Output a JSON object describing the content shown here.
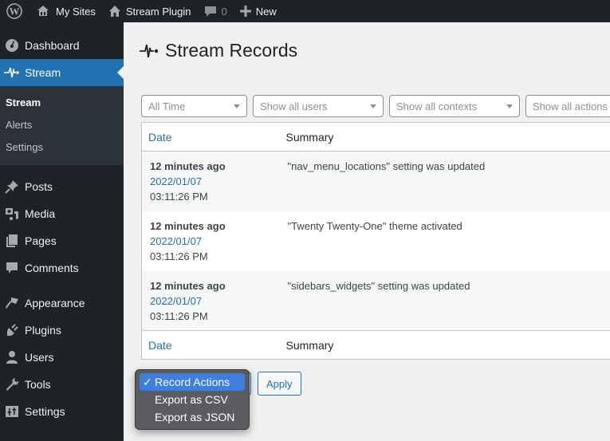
{
  "adminbar": {
    "wp_logo_icon": "wordpress-logo-icon",
    "my_sites": "My Sites",
    "site_name": "Stream Plugin",
    "comments_count": "0",
    "new_label": "New"
  },
  "sidebar": {
    "items": [
      {
        "label": "Dashboard",
        "icon": "dashboard-icon"
      },
      {
        "label": "Stream",
        "icon": "stream-icon",
        "current": true
      },
      {
        "label": "Posts",
        "icon": "pin-icon"
      },
      {
        "label": "Media",
        "icon": "media-icon"
      },
      {
        "label": "Pages",
        "icon": "pages-icon"
      },
      {
        "label": "Comments",
        "icon": "comments-icon"
      },
      {
        "label": "Appearance",
        "icon": "brush-icon"
      },
      {
        "label": "Plugins",
        "icon": "plugin-icon"
      },
      {
        "label": "Users",
        "icon": "user-icon"
      },
      {
        "label": "Tools",
        "icon": "wrench-icon"
      },
      {
        "label": "Settings",
        "icon": "settings-icon"
      }
    ],
    "submenu": [
      {
        "label": "Stream",
        "active": true
      },
      {
        "label": "Alerts"
      },
      {
        "label": "Settings"
      }
    ]
  },
  "page": {
    "title": "Stream Records"
  },
  "filters": [
    {
      "value": "All Time"
    },
    {
      "value": "Show all users"
    },
    {
      "value": "Show all contexts"
    },
    {
      "value": "Show all actions"
    }
  ],
  "table": {
    "columns": [
      "Date",
      "Summary"
    ],
    "rows": [
      {
        "ago": "12 minutes ago",
        "date": "2022/01/07",
        "time": "03:11:26 PM",
        "summary": "\"nav_menu_locations\" setting was updated"
      },
      {
        "ago": "12 minutes ago",
        "date": "2022/01/07",
        "time": "03:11:26 PM",
        "summary": "\"Twenty Twenty-One\" theme activated"
      },
      {
        "ago": "12 minutes ago",
        "date": "2022/01/07",
        "time": "03:11:26 PM",
        "summary": "\"sidebars_widgets\" setting was updated"
      }
    ]
  },
  "bulk": {
    "apply_label": "Apply",
    "options": [
      "Record Actions",
      "Export as CSV",
      "Export as JSON"
    ],
    "selected": "Record Actions",
    "check": "✓"
  },
  "colors": {
    "accent": "#2271b1",
    "adminbar_bg": "#1d2327",
    "dropdown_highlight": "#3d7ee0"
  }
}
